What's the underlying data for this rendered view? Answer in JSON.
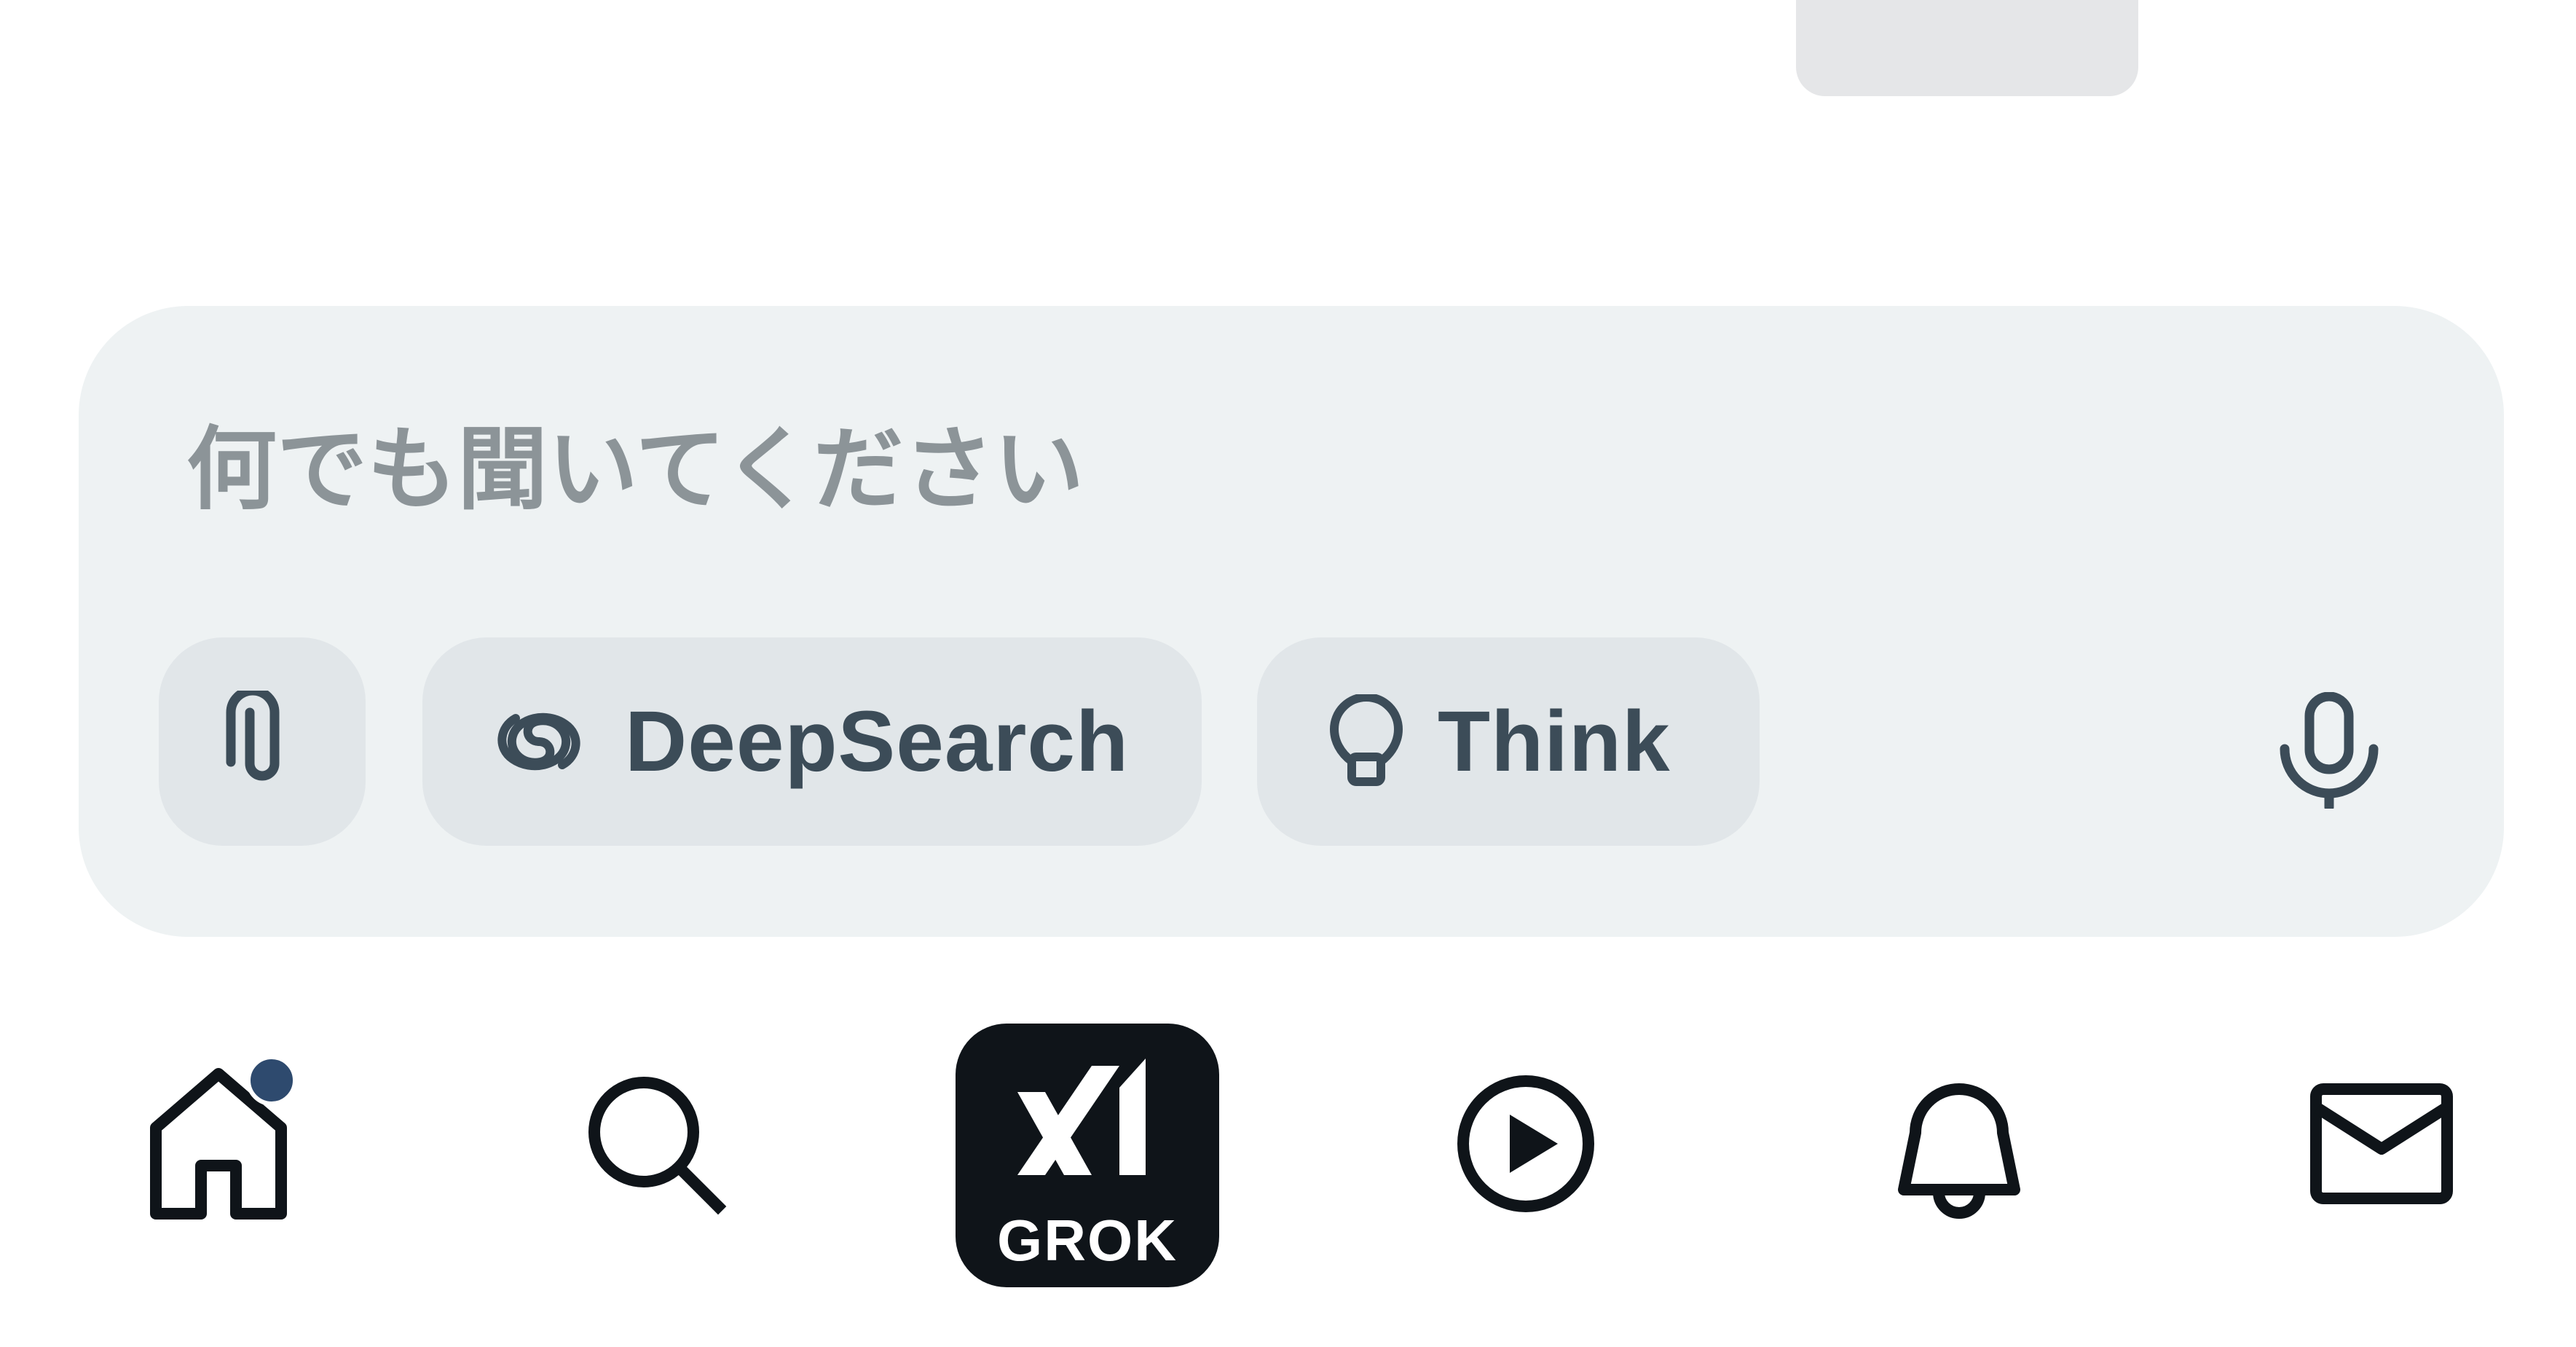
{
  "composer": {
    "placeholder": "何でも聞いてください",
    "value": "",
    "chips": {
      "attach_icon": "paperclip-icon",
      "deepsearch_label": "DeepSearch",
      "deepsearch_icon": "swirl-icon",
      "think_label": "Think",
      "think_icon": "lightbulb-icon"
    },
    "mic_icon": "microphone-icon"
  },
  "bottom_nav": {
    "items": [
      {
        "id": "home",
        "icon": "home-icon",
        "has_badge": true
      },
      {
        "id": "search",
        "icon": "search-icon"
      },
      {
        "id": "grok",
        "icon": "grok-logo",
        "label": "GROK"
      },
      {
        "id": "video",
        "icon": "play-icon"
      },
      {
        "id": "notifications",
        "icon": "bell-icon"
      },
      {
        "id": "messages",
        "icon": "mail-icon"
      }
    ]
  },
  "colors": {
    "composer_bg": "#eef2f3",
    "chip_bg": "#e1e6e9",
    "chip_text": "#3c4c58",
    "placeholder": "#8c9498",
    "nav_icon": "#0f1419",
    "badge": "#2e4a6e"
  }
}
